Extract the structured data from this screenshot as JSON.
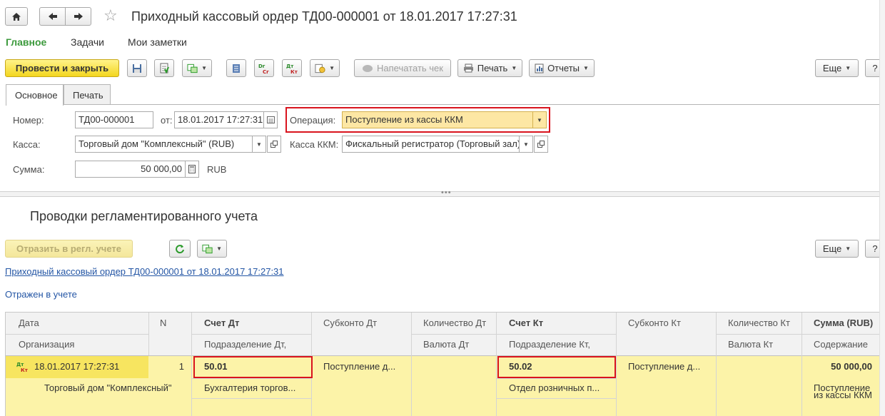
{
  "window": {
    "title": "Приходный кассовый ордер ТД00-000001 от 18.01.2017 17:27:31"
  },
  "sections": [
    "Главное",
    "Задачи",
    "Мои заметки"
  ],
  "toolbar": {
    "post_close": "Провести и закрыть",
    "print_check": "Напечатать чек",
    "print": "Печать",
    "reports": "Отчеты",
    "more": "Еще",
    "help": "?"
  },
  "form_tabs": [
    "Основное",
    "Печать"
  ],
  "fields": {
    "number_label": "Номер:",
    "number_value": "ТД00-000001",
    "date_label": "от:",
    "date_value": "18.01.2017 17:27:31",
    "operation_label": "Операция:",
    "operation_value": "Поступление из кассы ККМ",
    "kassa_label": "Касса:",
    "kassa_value": "Торговый дом \"Комплексный\" (RUB)",
    "kassa_kkm_label": "Касса ККМ:",
    "kassa_kkm_value": "Фискальный регистратор (Торговый зал)",
    "sum_label": "Сумма:",
    "sum_value": "50 000,00",
    "currency": "RUB"
  },
  "postings": {
    "heading": "Проводки регламентированного учета",
    "reflect_button": "Отразить в регл. учете",
    "more": "Еще",
    "help": "?",
    "doc_link": "Приходный кассовый ордер ТД00-000001 от 18.01.2017 17:27:31",
    "status": "Отражен в учете",
    "headers": {
      "date": "Дата",
      "n": "N",
      "account_dt": "Счет Дт",
      "subconto_dt": "Субконто Дт",
      "qty_dt": "Количество Дт",
      "account_kt": "Счет Кт",
      "subconto_kt": "Субконто Кт",
      "qty_kt": "Количество Кт",
      "amount": "Сумма (RUB)",
      "organization": "Организация",
      "division_dt": "Подразделение Дт,",
      "currency_dt": "Валюта Дт",
      "division_kt": "Подразделение Кт,",
      "currency_kt": "Валюта Кт",
      "content": "Содержание"
    },
    "row": {
      "icon": "ДтКт",
      "date": "18.01.2017 17:27:31",
      "n": "1",
      "account_dt": "50.01",
      "subconto_dt": "Поступление д...",
      "account_kt": "50.02",
      "subconto_kt": "Поступление д...",
      "amount": "50 000,00",
      "organization": "Торговый дом \"Комплексный\"",
      "division_dt": "Бухгалтерия торгов...",
      "division_kt": "Отдел розничных п...",
      "content_line1": "Поступление",
      "content_line2": "из кассы ККМ"
    }
  },
  "colors": {
    "accent_green": "#3c9a3c",
    "primary_yellow": "#f3d61f",
    "row_selected": "#f7e560",
    "row_yellow": "#fcf3a8",
    "highlight_red": "#d9141e",
    "link_blue": "#2456a5"
  }
}
